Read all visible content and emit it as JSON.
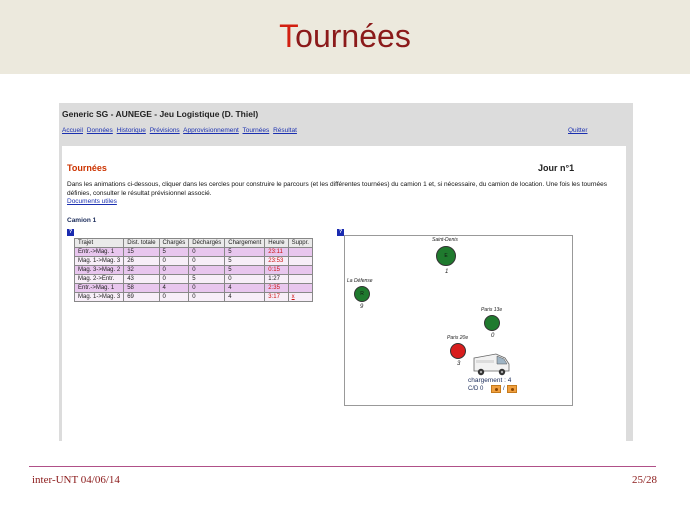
{
  "slide": {
    "title_first_letter": "T",
    "title_rest": "ournées",
    "footer_left": "inter-UNT 04/06/14",
    "footer_right": "25/28"
  },
  "app": {
    "title": "Generic SG - AUNEGE - Jeu Logistique (D. Thiel)",
    "menu": [
      "Accueil",
      "Données",
      "Historique",
      "Prévisions",
      "Approvisionnement",
      "Tournées",
      "Résultat"
    ],
    "quit": "Quitter",
    "section_title": "Tournées",
    "day": "Jour n°1",
    "instructions": "Dans les animations ci-dessous, cliquer dans les cercles pour construire le parcours (et les différentes tournées) du camion 1 et, si nécessaire, du camion de location. Une fois les tournées définies, consulter le résultat prévisionnel associé.",
    "doc_link": "Documents utiles",
    "truck_title": "Camion 1",
    "help_label": "?"
  },
  "table": {
    "headers": [
      "Trajet",
      "Dist. totale",
      "Chargés",
      "Déchargés",
      "Chargement",
      "Heure",
      "Suppr."
    ],
    "rows": [
      [
        "Entr.->Mag. 1",
        "15",
        "5",
        "0",
        "5",
        "23:11",
        ""
      ],
      [
        "Mag. 1->Mag. 3",
        "26",
        "0",
        "0",
        "5",
        "23:53",
        ""
      ],
      [
        "Mag. 3->Mag. 2",
        "32",
        "0",
        "0",
        "5",
        "0:15",
        ""
      ],
      [
        "Mag. 2->Entr.",
        "43",
        "0",
        "5",
        "0",
        "1:27",
        ""
      ],
      [
        "Entr.->Mag. 1",
        "58",
        "4",
        "0",
        "4",
        "2:35",
        ""
      ],
      [
        "Mag. 1->Mag. 3",
        "69",
        "0",
        "0",
        "4",
        "3:17",
        "x"
      ]
    ]
  },
  "map": {
    "nodes": [
      {
        "name": "Saint-Denis",
        "letter": "E",
        "count": "1",
        "color": "green"
      },
      {
        "name": "La Défense",
        "letter": "R",
        "count": "9",
        "color": "green"
      },
      {
        "name": "Paris 13e",
        "letter": "",
        "count": "0",
        "color": "green"
      },
      {
        "name": "Paris 20e",
        "letter": "",
        "count": "3",
        "color": "red"
      }
    ],
    "load_label": "chargement : 4",
    "cd_label": "C/D 0",
    "cd_sep": "/",
    "truck_icon": "delivery-van-icon"
  },
  "colors": {
    "header_band": "#ece9dd",
    "title": "#8b1a1a",
    "link": "#1a2fb0",
    "row_odd": "#e8c6ee",
    "row_even": "#f7eef8",
    "node_green": "#1f7a2e",
    "node_red": "#d81e1e"
  }
}
